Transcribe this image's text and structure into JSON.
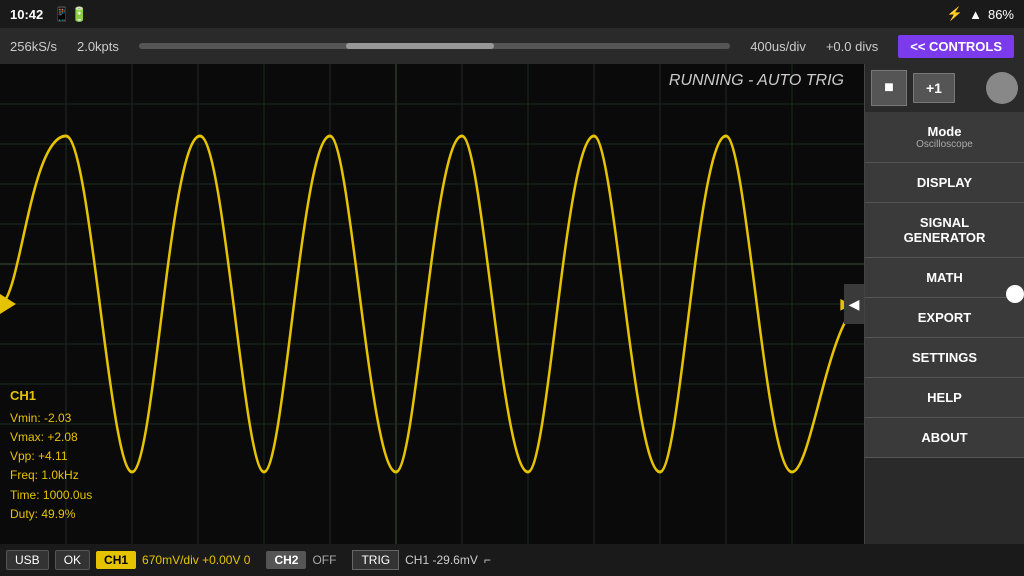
{
  "statusBar": {
    "time": "10:42",
    "battery": "86%"
  },
  "toolbar": {
    "sampleRate": "256kS/s",
    "points": "2.0kpts",
    "timeDiv": "400us/div",
    "offset": "+0.0 divs",
    "controlsLabel": "<< CONTROLS"
  },
  "scope": {
    "runningStatus": "RUNNING - AUTO TRIG",
    "gridColor": "#1e1e1e",
    "waveColor": "#e6c300"
  },
  "measurements": {
    "channel": "CH1",
    "vmin": "Vmin: -2.03",
    "vmax": "Vmax: +2.08",
    "vpp": "Vpp: +4.11",
    "freq": "Freq: 1.0kHz",
    "time": "Time: 1000.0us",
    "duty": "Duty: 49.9%"
  },
  "rightPanel": {
    "stopIcon": "■",
    "plusOne": "+1",
    "modeLabel": "Mode",
    "modeSubLabel": "Oscilloscope",
    "displayLabel": "DISPLAY",
    "signalGenLabel": "SIGNAL\nGENERATOR",
    "mathLabel": "MATH",
    "exportLabel": "EXPORT",
    "settingsLabel": "SETTINGS",
    "helpLabel": "HELP",
    "aboutLabel": "ABOUT"
  },
  "bottomBar": {
    "usbLabel": "USB",
    "okLabel": "OK",
    "ch1Label": "CH1",
    "ch1Info": "670mV/div  +0.00V  0",
    "ch2Label": "CH2",
    "ch2Info": "OFF",
    "trigLabel": "TRIG",
    "trigInfo": "CH1  -29.6mV",
    "trigIcon": "⌐"
  }
}
